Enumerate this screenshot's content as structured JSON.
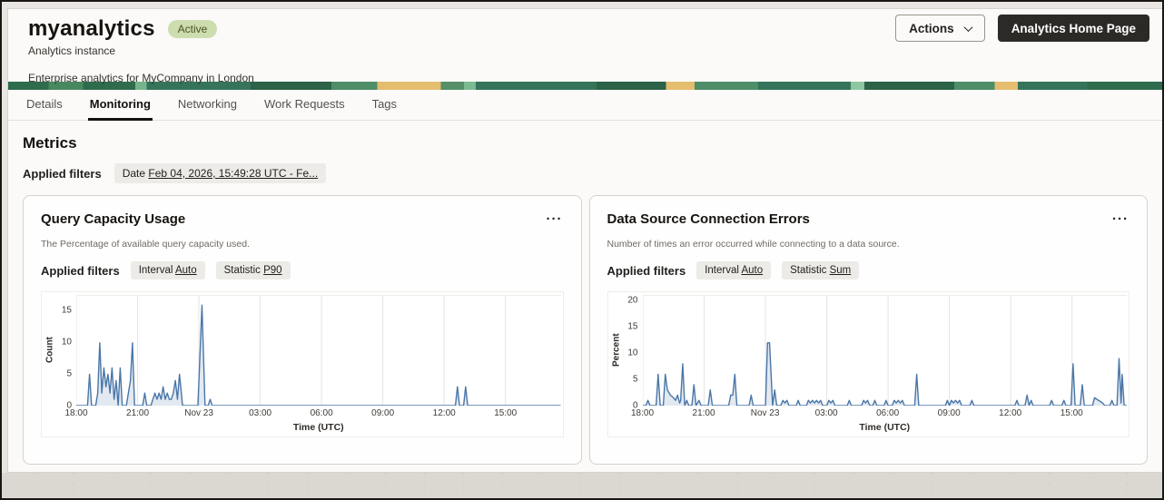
{
  "colors": {
    "accent_line": "#4a76a8",
    "accent_fill": "rgba(74,118,168,0.16)",
    "badge_bg": "#cdddaf",
    "badge_text": "#49541f",
    "dark_button_bg": "#2c2a26",
    "banner_greens": [
      "#2c6247",
      "#35745a",
      "#4d8e68",
      "#8fc6a2"
    ],
    "banner_yellow": "#e4bd6f"
  },
  "icons": {
    "ellipsis_menu": "···"
  },
  "header": {
    "title": "myanalytics",
    "status_badge": "Active",
    "instance_type": "Analytics instance",
    "description": "Enterprise analytics for MyCompany in London",
    "actions_button": "Actions",
    "home_button": "Analytics Home Page"
  },
  "tabs": [
    {
      "label": "Details",
      "active": false
    },
    {
      "label": "Monitoring",
      "active": true
    },
    {
      "label": "Networking",
      "active": false
    },
    {
      "label": "Work Requests",
      "active": false
    },
    {
      "label": "Tags",
      "active": false
    }
  ],
  "metrics": {
    "heading": "Metrics",
    "applied_filters_label": "Applied filters",
    "date_filter": {
      "label": "Date",
      "value": "Feb 04, 2026, 15:49:28 UTC - Fe..."
    }
  },
  "cards": [
    {
      "title": "Query Capacity Usage",
      "description": "The Percentage of available query capacity used.",
      "applied_filters_label": "Applied filters",
      "filters": [
        {
          "label": "Interval",
          "value": "Auto"
        },
        {
          "label": "Statistic",
          "value": "P90"
        }
      ]
    },
    {
      "title": "Data Source Connection Errors",
      "description": "Number of times an error occurred while connecting to a data source.",
      "applied_filters_label": "Applied filters",
      "filters": [
        {
          "label": "Interval",
          "value": "Auto"
        },
        {
          "label": "Statistic",
          "value": "Sum"
        }
      ]
    }
  ],
  "chart_data": [
    {
      "type": "line",
      "title": "Query Capacity Usage",
      "xlabel": "Time (UTC)",
      "ylabel": "Count",
      "x_hours_range": [
        0,
        23.7
      ],
      "x_ticks": [
        {
          "t": 0,
          "label": "18:00"
        },
        {
          "t": 3,
          "label": "21:00"
        },
        {
          "t": 6,
          "label": "Nov 23"
        },
        {
          "t": 9,
          "label": "03:00"
        },
        {
          "t": 12,
          "label": "06:00"
        },
        {
          "t": 15,
          "label": "09:00"
        },
        {
          "t": 18,
          "label": "12:00"
        },
        {
          "t": 21,
          "label": "15:00"
        }
      ],
      "ylim": [
        0,
        17.5
      ],
      "y_ticks": [
        0,
        5,
        10,
        15
      ],
      "grid": "vertical",
      "legend": "none",
      "line_color": "#4a76a8",
      "fill_color": "rgba(74,118,168,0.16)",
      "points": [
        [
          0,
          0
        ],
        [
          0.55,
          0
        ],
        [
          0.65,
          5
        ],
        [
          0.75,
          0
        ],
        [
          0.95,
          0
        ],
        [
          1.05,
          2
        ],
        [
          1.15,
          10
        ],
        [
          1.25,
          2
        ],
        [
          1.35,
          6
        ],
        [
          1.45,
          3
        ],
        [
          1.55,
          5
        ],
        [
          1.65,
          2
        ],
        [
          1.75,
          6
        ],
        [
          1.85,
          1
        ],
        [
          1.95,
          4
        ],
        [
          2.05,
          0
        ],
        [
          2.15,
          6
        ],
        [
          2.25,
          0
        ],
        [
          2.45,
          0
        ],
        [
          2.55,
          2
        ],
        [
          2.65,
          4
        ],
        [
          2.75,
          10
        ],
        [
          2.85,
          0
        ],
        [
          3.25,
          0
        ],
        [
          3.35,
          2
        ],
        [
          3.45,
          0
        ],
        [
          3.65,
          0
        ],
        [
          3.75,
          1
        ],
        [
          3.85,
          2
        ],
        [
          3.95,
          1
        ],
        [
          4.05,
          2
        ],
        [
          4.15,
          1
        ],
        [
          4.25,
          3
        ],
        [
          4.35,
          1
        ],
        [
          4.45,
          2
        ],
        [
          4.55,
          1
        ],
        [
          4.65,
          1
        ],
        [
          4.75,
          2
        ],
        [
          4.85,
          4
        ],
        [
          4.95,
          1
        ],
        [
          5.05,
          5
        ],
        [
          5.2,
          0
        ],
        [
          5.95,
          0
        ],
        [
          6.05,
          8
        ],
        [
          6.15,
          16
        ],
        [
          6.3,
          0
        ],
        [
          6.45,
          0
        ],
        [
          6.55,
          1
        ],
        [
          6.65,
          0
        ],
        [
          18.55,
          0
        ],
        [
          18.65,
          3
        ],
        [
          18.75,
          0
        ],
        [
          18.95,
          0
        ],
        [
          19.05,
          3
        ],
        [
          19.15,
          0
        ],
        [
          23.7,
          0
        ]
      ]
    },
    {
      "type": "line",
      "title": "Data Source Connection Errors",
      "xlabel": "Time (UTC)",
      "ylabel": "Percent",
      "x_hours_range": [
        0,
        23.7
      ],
      "x_ticks": [
        {
          "t": 0,
          "label": "18:00"
        },
        {
          "t": 3,
          "label": "21:00"
        },
        {
          "t": 6,
          "label": "Nov 23"
        },
        {
          "t": 9,
          "label": "03:00"
        },
        {
          "t": 12,
          "label": "06:00"
        },
        {
          "t": 15,
          "label": "09:00"
        },
        {
          "t": 18,
          "label": "12:00"
        },
        {
          "t": 21,
          "label": "15:00"
        }
      ],
      "ylim": [
        0,
        21
      ],
      "y_ticks": [
        0,
        5,
        10,
        15,
        20
      ],
      "grid": "vertical",
      "legend": "none",
      "line_color": "#4a76a8",
      "fill_color": "rgba(74,118,168,0.16)",
      "points": [
        [
          0,
          0
        ],
        [
          0.15,
          0
        ],
        [
          0.25,
          1
        ],
        [
          0.35,
          0
        ],
        [
          0.65,
          0
        ],
        [
          0.75,
          6
        ],
        [
          0.85,
          0
        ],
        [
          1.0,
          0
        ],
        [
          1.1,
          6
        ],
        [
          1.2,
          3
        ],
        [
          1.35,
          2
        ],
        [
          1.5,
          1.5
        ],
        [
          1.6,
          1
        ],
        [
          1.7,
          2
        ],
        [
          1.8,
          0.5
        ],
        [
          1.85,
          1
        ],
        [
          1.95,
          8
        ],
        [
          2.05,
          0
        ],
        [
          2.15,
          1
        ],
        [
          2.25,
          0
        ],
        [
          2.4,
          0
        ],
        [
          2.5,
          4
        ],
        [
          2.6,
          0
        ],
        [
          2.75,
          1
        ],
        [
          2.85,
          0
        ],
        [
          3.2,
          0
        ],
        [
          3.3,
          3
        ],
        [
          3.4,
          0
        ],
        [
          4.2,
          0
        ],
        [
          4.3,
          2
        ],
        [
          4.4,
          2
        ],
        [
          4.5,
          6
        ],
        [
          4.6,
          0
        ],
        [
          5.2,
          0
        ],
        [
          5.3,
          2
        ],
        [
          5.4,
          0
        ],
        [
          6.0,
          0
        ],
        [
          6.1,
          12
        ],
        [
          6.2,
          12
        ],
        [
          6.35,
          0
        ],
        [
          6.45,
          3
        ],
        [
          6.55,
          0
        ],
        [
          6.75,
          0
        ],
        [
          6.85,
          1
        ],
        [
          6.95,
          0.5
        ],
        [
          7.05,
          1
        ],
        [
          7.15,
          0
        ],
        [
          7.5,
          0
        ],
        [
          7.6,
          1
        ],
        [
          7.7,
          0
        ],
        [
          8.0,
          0
        ],
        [
          8.1,
          1
        ],
        [
          8.2,
          0.5
        ],
        [
          8.3,
          1
        ],
        [
          8.4,
          0.5
        ],
        [
          8.5,
          1
        ],
        [
          8.6,
          0.5
        ],
        [
          8.7,
          1
        ],
        [
          8.8,
          0
        ],
        [
          9.0,
          0
        ],
        [
          9.1,
          1
        ],
        [
          9.2,
          0.5
        ],
        [
          9.3,
          1
        ],
        [
          9.4,
          0
        ],
        [
          10.0,
          0
        ],
        [
          10.1,
          1
        ],
        [
          10.2,
          0
        ],
        [
          10.7,
          0
        ],
        [
          10.8,
          1
        ],
        [
          10.9,
          0.5
        ],
        [
          11.0,
          1
        ],
        [
          11.1,
          0
        ],
        [
          11.25,
          0
        ],
        [
          11.35,
          1
        ],
        [
          11.45,
          0
        ],
        [
          11.8,
          0
        ],
        [
          11.9,
          1
        ],
        [
          12.0,
          0
        ],
        [
          12.2,
          0
        ],
        [
          12.3,
          1
        ],
        [
          12.4,
          0.5
        ],
        [
          12.5,
          1
        ],
        [
          12.6,
          0.5
        ],
        [
          12.7,
          1
        ],
        [
          12.8,
          0
        ],
        [
          13.3,
          0
        ],
        [
          13.4,
          6
        ],
        [
          13.5,
          0
        ],
        [
          14.8,
          0
        ],
        [
          14.9,
          1
        ],
        [
          15.0,
          0
        ],
        [
          15.1,
          1
        ],
        [
          15.2,
          0.5
        ],
        [
          15.3,
          1
        ],
        [
          15.4,
          0.5
        ],
        [
          15.5,
          1
        ],
        [
          15.6,
          0
        ],
        [
          16.0,
          0
        ],
        [
          16.1,
          1
        ],
        [
          16.2,
          0
        ],
        [
          18.2,
          0
        ],
        [
          18.3,
          1
        ],
        [
          18.4,
          0
        ],
        [
          18.7,
          0
        ],
        [
          18.8,
          2
        ],
        [
          18.9,
          0
        ],
        [
          19.0,
          1
        ],
        [
          19.1,
          0
        ],
        [
          19.9,
          0
        ],
        [
          20.0,
          1
        ],
        [
          20.1,
          0
        ],
        [
          20.5,
          0
        ],
        [
          20.6,
          1
        ],
        [
          20.7,
          0
        ],
        [
          20.95,
          0
        ],
        [
          21.05,
          8
        ],
        [
          21.15,
          0
        ],
        [
          21.4,
          0
        ],
        [
          21.5,
          4
        ],
        [
          21.6,
          0
        ],
        [
          22.0,
          0
        ],
        [
          22.1,
          1.5
        ],
        [
          22.3,
          1
        ],
        [
          22.5,
          0.5
        ],
        [
          22.6,
          0
        ],
        [
          22.85,
          0
        ],
        [
          22.95,
          1
        ],
        [
          23.05,
          0
        ],
        [
          23.2,
          0
        ],
        [
          23.3,
          9
        ],
        [
          23.4,
          0.5
        ],
        [
          23.45,
          6
        ],
        [
          23.55,
          0
        ],
        [
          23.7,
          0
        ]
      ]
    }
  ]
}
